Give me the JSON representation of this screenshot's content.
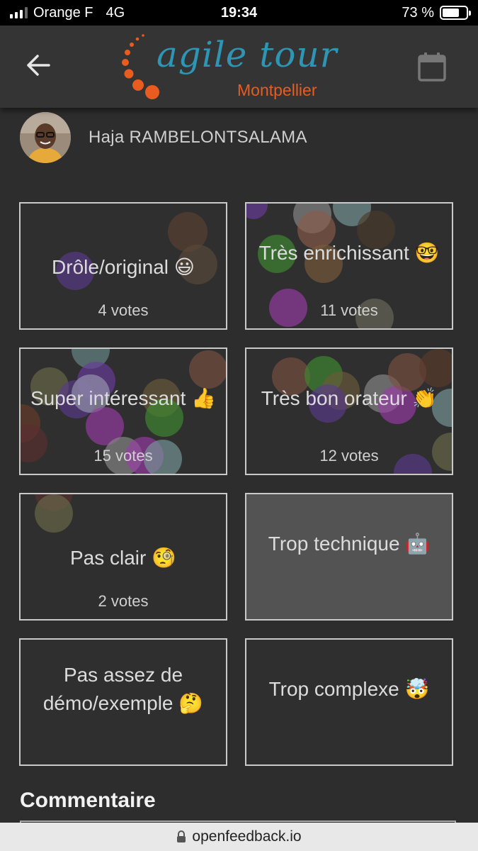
{
  "status_bar": {
    "carrier": "Orange F",
    "network": "4G",
    "time": "19:34",
    "battery_percent": "73 %",
    "battery_level": 0.73
  },
  "header": {
    "logo_title": "agile tour",
    "logo_subtitle": "Montpellier",
    "back_icon": "arrow-left-icon",
    "calendar_icon": "calendar-icon",
    "colors": {
      "logo_blue": "#2f95b4",
      "logo_orange": "#e85c1f"
    }
  },
  "speaker": {
    "name": "Haja RAMBELONTSALAMA"
  },
  "votes": [
    {
      "label": "Drôle/original 😃",
      "votes": "4 votes",
      "selected": false
    },
    {
      "label": "Très enrichissant 🤓",
      "votes": "11 votes",
      "selected": false
    },
    {
      "label": "Super intéressant 👍",
      "votes": "15 votes",
      "selected": false
    },
    {
      "label": "Très bon orateur 👏",
      "votes": "12 votes",
      "selected": false
    },
    {
      "label": "Pas clair 🧐",
      "votes": "2 votes",
      "selected": false
    },
    {
      "label": "Trop technique 🤖",
      "votes": "",
      "selected": true
    },
    {
      "label": "Pas assez de démo/exemple 🤔",
      "votes": "",
      "selected": false
    },
    {
      "label": "Trop complexe 🤯",
      "votes": "",
      "selected": false
    }
  ],
  "comment": {
    "title": "Commentaire"
  },
  "url_bar": {
    "domain": "openfeedback.io",
    "lock_icon": "lock-icon"
  }
}
